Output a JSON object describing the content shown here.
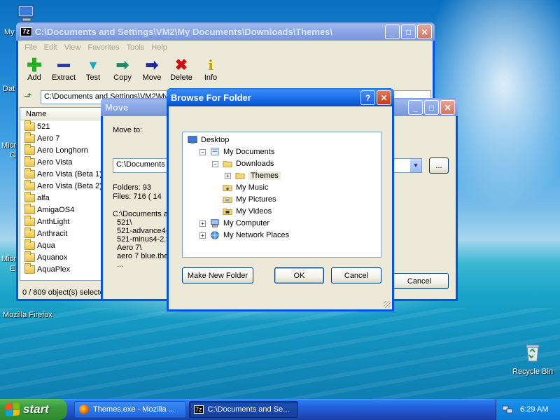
{
  "desktop": {
    "labels": [
      "My",
      "Dat",
      "Micr",
      "E",
      "Micr",
      "C"
    ],
    "firefox_label": "Mozilla Firefox",
    "recycle_label": "Recycle Bin"
  },
  "main_window": {
    "title": "C:\\Documents and Settings\\VM2\\My Documents\\Downloads\\Themes\\",
    "app_badge": "7z",
    "menu": [
      "File",
      "Edit",
      "View",
      "Favorites",
      "Tools",
      "Help"
    ],
    "toolbar": [
      {
        "label": "Add",
        "icon": "add-icon"
      },
      {
        "label": "Extract",
        "icon": "extract-icon"
      },
      {
        "label": "Test",
        "icon": "test-icon"
      },
      {
        "label": "Copy",
        "icon": "copy-icon"
      },
      {
        "label": "Move",
        "icon": "move-icon"
      },
      {
        "label": "Delete",
        "icon": "delete-icon"
      },
      {
        "label": "Info",
        "icon": "info-icon"
      }
    ],
    "address": "C:\\Documents and Settings\\VM2\\My Documents\\Downloads\\Themes\\",
    "column_name": "Name",
    "files": [
      "521",
      "Aero 7",
      "Aero Longhorn",
      "Aero Vista",
      "Aero Vista (Beta 1)",
      "Aero Vista (Beta 2)",
      "alfa",
      "AmigaOS4",
      "AnthLight",
      "Anthracit",
      "Aqua",
      "Aquanox",
      "AquaPlex"
    ],
    "status": "0 / 809 object(s) selected"
  },
  "move_dialog": {
    "title": "Move",
    "move_to_label": "Move to:",
    "path_value": "C:\\Documents and Settings\\VM2\\My Documents\\Downloads\\Themes\\",
    "browse_label": "...",
    "folders": "Folders: 93",
    "files": "Files: 716   ( 14",
    "listing": [
      "C:\\Documents a",
      "521\\",
      "521-advance4-",
      "521-minus4-2.t",
      "Aero 7\\",
      "aero 7 blue.the",
      "..."
    ],
    "cancel_label": "Cancel"
  },
  "browse_dialog": {
    "title": "Browse For Folder",
    "help_label": "?",
    "close_label": "✕",
    "tree": [
      {
        "label": "Desktop",
        "indent": 0,
        "expander": "",
        "icon": "desktop-icon"
      },
      {
        "label": "My Documents",
        "indent": 1,
        "expander": "−",
        "icon": "my-documents-icon"
      },
      {
        "label": "Downloads",
        "indent": 2,
        "expander": "−",
        "icon": "folder-open-icon"
      },
      {
        "label": "Themes",
        "indent": 3,
        "expander": "+",
        "icon": "folder-icon",
        "selected": true
      },
      {
        "label": "My Music",
        "indent": 2,
        "expander": "",
        "icon": "my-music-icon"
      },
      {
        "label": "My Pictures",
        "indent": 2,
        "expander": "",
        "icon": "my-pictures-icon"
      },
      {
        "label": "My Videos",
        "indent": 2,
        "expander": "",
        "icon": "my-videos-icon"
      },
      {
        "label": "My Computer",
        "indent": 1,
        "expander": "+",
        "icon": "my-computer-icon"
      },
      {
        "label": "My Network Places",
        "indent": 1,
        "expander": "+",
        "icon": "network-places-icon"
      }
    ],
    "make_new_folder_label": "Make New Folder",
    "ok_label": "OK",
    "cancel_label": "Cancel"
  },
  "taskbar": {
    "start_label": "start",
    "tasks": [
      {
        "label": "Themes.exe - Mozilla ...",
        "icon": "firefox-icon"
      },
      {
        "label": "C:\\Documents and Se...",
        "icon": "7zip-icon"
      }
    ],
    "clock": "6:29 AM"
  },
  "colors": {
    "xp_blue": "#0054e3",
    "dialog_bg": "#ece9d8",
    "start_green": "#3a9a3a"
  }
}
